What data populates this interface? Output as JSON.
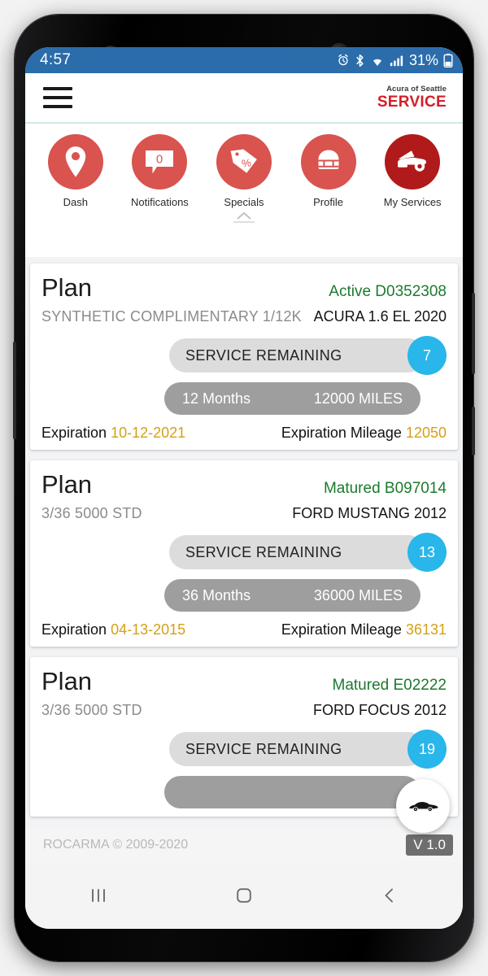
{
  "status_bar": {
    "time": "4:57",
    "battery_percent": "31%",
    "icons": [
      "alarm-icon",
      "bluetooth-icon",
      "wifi-icon",
      "signal-icon",
      "battery-icon"
    ]
  },
  "header": {
    "menu_icon": "hamburger-icon",
    "brand_top": "Acura of Seattle",
    "brand_bottom": "SERVICE",
    "brand_color": "#d31f2a"
  },
  "quick_nav": {
    "items": [
      {
        "label": "Dash",
        "icon": "map-pin-icon",
        "color": "#d9534f",
        "badge": ""
      },
      {
        "label": "Notifications",
        "icon": "speech-bubble-icon",
        "color": "#d9534f",
        "badge": "0"
      },
      {
        "label": "Specials",
        "icon": "price-tag-icon",
        "color": "#d9534f",
        "badge": ""
      },
      {
        "label": "Profile",
        "icon": "helmet-avatar-icon",
        "color": "#d9534f",
        "badge": ""
      },
      {
        "label": "My Services",
        "icon": "car-hood-open-icon",
        "color": "#b01a1a",
        "badge": ""
      }
    ],
    "handle_icon": "collapse-chevron-icon"
  },
  "plans": [
    {
      "title": "Plan",
      "status": "Active D0352308",
      "plan_name": "SYNTHETIC COMPLIMENTARY 1/12K",
      "vehicle": "ACURA 1.6 EL 2020",
      "service_remaining_label": "SERVICE REMAINING",
      "service_remaining_count": "7",
      "months": "12 Months",
      "miles": "12000 MILES",
      "expiration_label": "Expiration",
      "expiration_value": "10-12-2021",
      "expiration_mileage_label": "Expiration Mileage",
      "expiration_mileage_value": "12050"
    },
    {
      "title": "Plan",
      "status": "Matured B097014",
      "plan_name": "3/36 5000 STD",
      "vehicle": "FORD MUSTANG 2012",
      "service_remaining_label": "SERVICE REMAINING",
      "service_remaining_count": "13",
      "months": "36 Months",
      "miles": "36000 MILES",
      "expiration_label": "Expiration",
      "expiration_value": "04-13-2015",
      "expiration_mileage_label": "Expiration Mileage",
      "expiration_mileage_value": "36131"
    },
    {
      "title": "Plan",
      "status": "Matured E02222",
      "plan_name": "3/36 5000 STD",
      "vehicle": "FORD FOCUS 2012",
      "service_remaining_label": "SERVICE REMAINING",
      "service_remaining_count": "19",
      "months": "",
      "miles": "",
      "expiration_label": "",
      "expiration_value": "",
      "expiration_mileage_label": "",
      "expiration_mileage_value": ""
    }
  ],
  "fab": {
    "icon": "sports-car-icon"
  },
  "footer": {
    "copyright": "ROCARMA © 2009-2020",
    "version": "V 1.0"
  },
  "android_nav": {
    "recents_icon": "recents-icon",
    "home_icon": "home-icon",
    "back_icon": "back-icon"
  },
  "colors": {
    "status_bar": "#2b6cab",
    "accent_red": "#d9534f",
    "dark_red": "#b01a1a",
    "badge_blue": "#29b6ea",
    "status_green": "#1b7a2e",
    "value_amber": "#d4a017"
  }
}
